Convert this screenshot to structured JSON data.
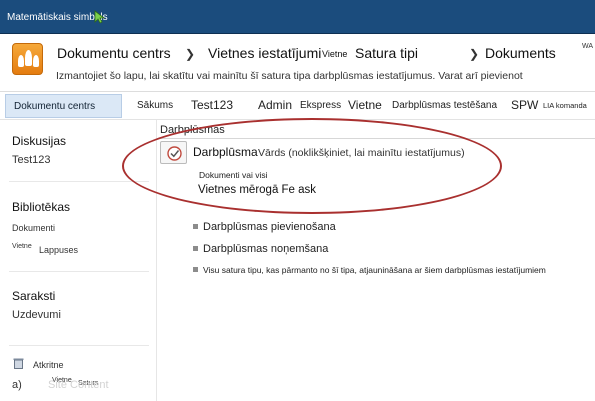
{
  "topbar": {
    "app_title": "Matemātiskais simbols"
  },
  "breadcrumb": {
    "item1": "Dokumentu centrs",
    "item2": "Vietnes iestatījumi",
    "item3_small": "Vietne",
    "item3": "Satura tipi",
    "item4": "Dokuments",
    "sep": "❯"
  },
  "header": {
    "right_fragment": "WA",
    "description": "Izmantojiet šo lapu, lai skatītu vai mainītu šī satura tipa darbplūsmas iestatījumus. Varat arī pievienot"
  },
  "nav": {
    "active": "Dokumentu centrs",
    "items": [
      "Sākums",
      "Test123",
      "Admin",
      "Ekspress",
      "Vietne",
      "Darbplūsmas testēšana",
      "SPW",
      "LIA komanda"
    ]
  },
  "leftnav": {
    "discussions_heading": "Diskusijas",
    "discussion_item": "Test123",
    "libraries_heading": "Bibliotēkas",
    "lib_documents": "Dokumenti",
    "lib_pages_small": "Vietne",
    "lib_pages": "Lappuses",
    "lists_heading": "Saraksti",
    "list_tasks": "Uzdevumi",
    "recycle": "Atkritne",
    "site_content_prefix": "a)",
    "site_content_small1": "Vietne",
    "site_content_small2": "Saturs",
    "site_content_ghost": "Site Content"
  },
  "main": {
    "section_title": "Darbplūsmas",
    "workflow_name": "Darbplūsma",
    "workflow_hint": "Vārds (noklikšķiniet, lai mainītu iestatījumus)",
    "doc_label": "Dokumenti vai visi",
    "site_workflow": "Vietnes mērogā Fe ask",
    "links": [
      "Darbplūsmas pievienošana",
      "Darbplūsmas noņemšana",
      "Visu satura tipu, kas pārmanto no šī tipa, atjaunināšana ar šiem darbplūsmas iestatījumiem"
    ]
  },
  "colors": {
    "topbar": "#1b4c7d",
    "accent_oval": "#a9302f",
    "active_tab": "#dbe8f6"
  }
}
